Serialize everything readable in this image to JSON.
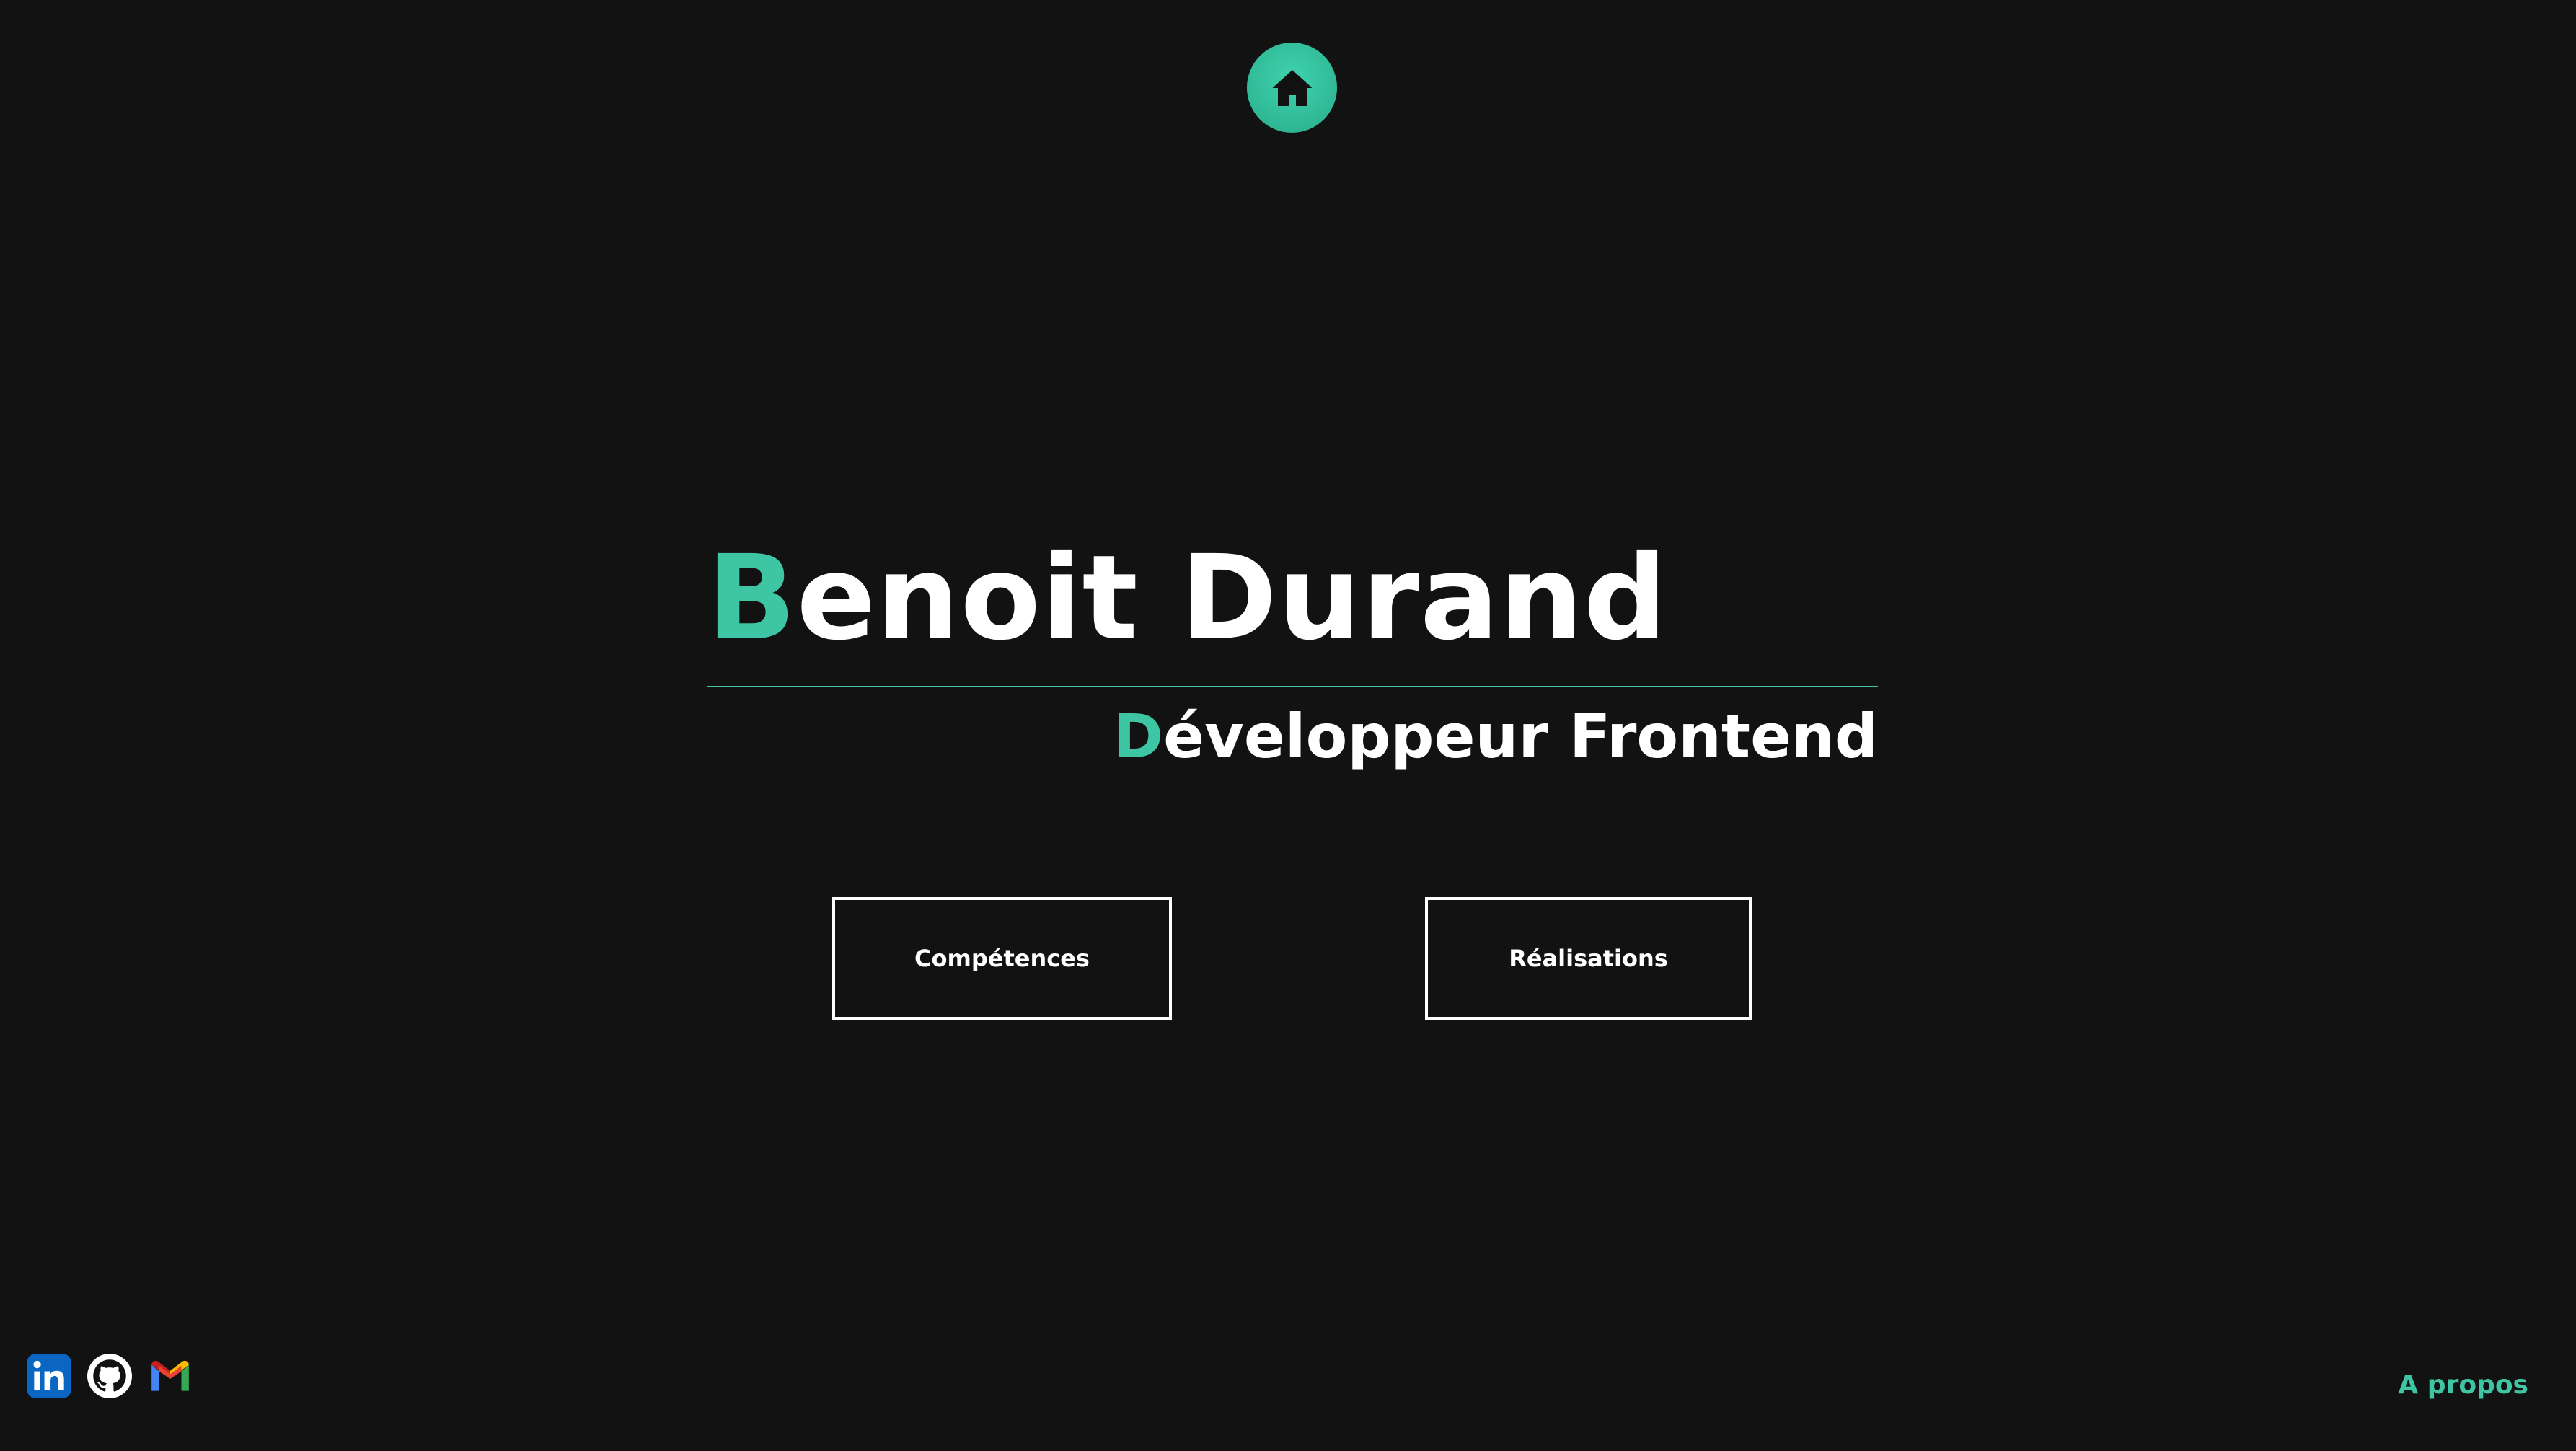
{
  "header": {
    "home_icon": "home-icon"
  },
  "hero": {
    "name_initial": "B",
    "name_rest": "enoit Durand",
    "role_initial": "D",
    "role_rest": "éveloppeur Frontend"
  },
  "nav": {
    "competences_label": "Compétences",
    "realisations_label": "Réalisations"
  },
  "footer": {
    "social_icons": [
      "linkedin-icon",
      "github-icon",
      "gmail-icon"
    ],
    "about_label": "A propos"
  },
  "colors": {
    "background": "#121212",
    "accent": "#3ec6a4",
    "text": "#ffffff"
  }
}
